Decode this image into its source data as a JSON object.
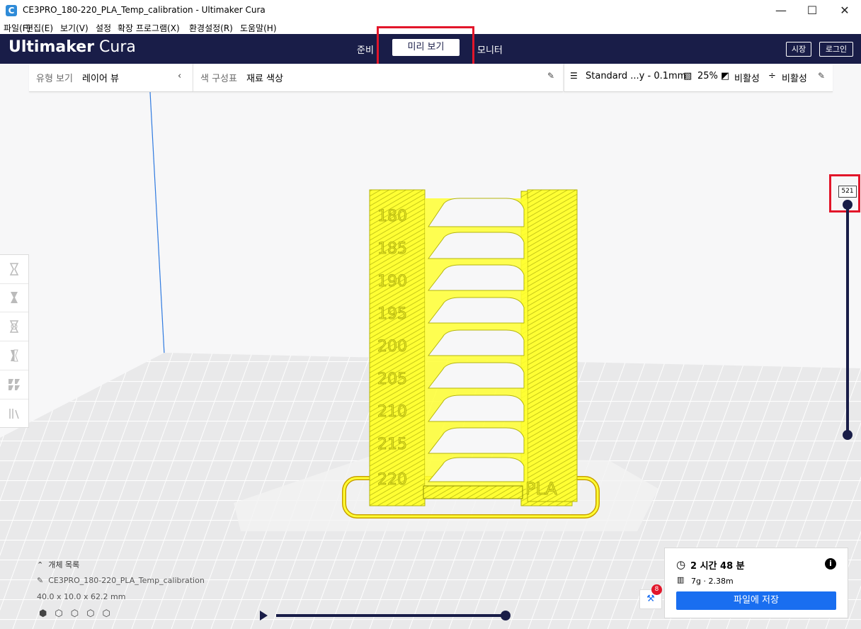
{
  "window": {
    "title": "CE3PRO_180-220_PLA_Temp_calibration - Ultimaker Cura",
    "minimize": "—",
    "maximize": "☐",
    "close": "✕"
  },
  "menu": [
    {
      "label": "파일(F)"
    },
    {
      "label": "편집(E)"
    },
    {
      "label": "보기(V)"
    },
    {
      "label": "설정"
    },
    {
      "label": "확장 프로그램(X)"
    },
    {
      "label": "환경설정(R)"
    },
    {
      "label": "도움말(H)"
    }
  ],
  "header": {
    "brand_bold": "Ultimaker",
    "brand_light": " Cura",
    "tabs": [
      "준비",
      "미리 보기",
      "모니터"
    ],
    "marketplace": "시장",
    "login": "로그인"
  },
  "view_panel": {
    "label": "유형 보기",
    "value": "레이어 뷰",
    "color_label": "색 구성표",
    "color_value": "재료 색상"
  },
  "print_settings": {
    "profile": "Standard ...y - 0.1mm",
    "infill": "25%",
    "support": "비활성",
    "adhesion": "비활성"
  },
  "layer_slider": {
    "current": "521",
    "fraction": 1.0
  },
  "model": {
    "temp_labels": [
      "180",
      "185",
      "190",
      "195",
      "200",
      "205",
      "210",
      "215",
      "220"
    ],
    "side_label": "PLA",
    "color": "#ffff33"
  },
  "object_list": {
    "header": "개체 목록",
    "filename": "CE3PRO_180-220_PLA_Temp_calibration",
    "dimensions": "40.0 x 10.0 x 62.2 mm"
  },
  "print_info": {
    "time": "2 시간 48 분",
    "material": "7g · 2.38m",
    "save_button": "파일에 저장",
    "notification_count": "8"
  },
  "colors": {
    "header_bg": "#191d48",
    "accent_blue": "#196ef0",
    "highlight_red": "#e2162a"
  }
}
